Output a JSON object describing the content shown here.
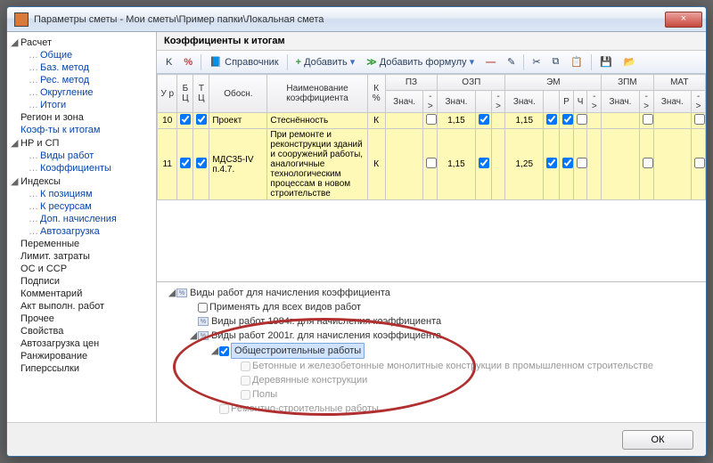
{
  "titlebar": {
    "text": "Параметры сметы - Мои сметы\\Пример папки\\Локальная смета"
  },
  "close_glyph": "×",
  "sidebar": {
    "items": [
      {
        "label": "Расчет",
        "level": 0,
        "caret": "◢"
      },
      {
        "label": "Общие",
        "level": 1
      },
      {
        "label": "Баз. метод",
        "level": 1
      },
      {
        "label": "Рес. метод",
        "level": 1
      },
      {
        "label": "Округление",
        "level": 1
      },
      {
        "label": "Итоги",
        "level": 1
      },
      {
        "label": "Регион и зона",
        "level": 0
      },
      {
        "label": "Коэф-ты к итогам",
        "level": 0,
        "selected": true
      },
      {
        "label": "НР и СП",
        "level": 0,
        "caret": "◢"
      },
      {
        "label": "Виды работ",
        "level": 1
      },
      {
        "label": "Коэффициенты",
        "level": 1
      },
      {
        "label": "Индексы",
        "level": 0,
        "caret": "◢"
      },
      {
        "label": "К позициям",
        "level": 1
      },
      {
        "label": "К ресурсам",
        "level": 1
      },
      {
        "label": "Доп. начисления",
        "level": 1
      },
      {
        "label": "Автозагрузка",
        "level": 1
      },
      {
        "label": "Переменные",
        "level": 0
      },
      {
        "label": "Лимит. затраты",
        "level": 0
      },
      {
        "label": "ОС и ССР",
        "level": 0
      },
      {
        "label": "Подписи",
        "level": 0
      },
      {
        "label": "Комментарий",
        "level": 0
      },
      {
        "label": "Акт выполн. работ",
        "level": 0
      },
      {
        "label": "Прочее",
        "level": 0
      },
      {
        "label": "Свойства",
        "level": 0
      },
      {
        "label": "Автозагрузка цен",
        "level": 0
      },
      {
        "label": "Ранжирование",
        "level": 0
      },
      {
        "label": "Гиперссылки",
        "level": 0
      }
    ]
  },
  "main": {
    "header": "Коэффициенты к итогам",
    "toolbar": {
      "k_label": "K",
      "pct_label": "%",
      "handbook": "Справочник",
      "add": "Добавить",
      "add_formula": "Добавить формулу",
      "minus_glyph": "—",
      "edit_glyph": "✎",
      "cut_glyph": "✂",
      "copy_glyph": "⧉",
      "paste_glyph": "📋",
      "save_glyph": "💾",
      "open_glyph": "📂",
      "dropdown_glyph": "▾",
      "plus_glyph": "+",
      "formula_glyph": "≫"
    },
    "columns": {
      "ur": "У\nр",
      "bc": "Б\nЦ",
      "tc": "Т\nЦ",
      "obosn": "Обосн.",
      "naim": "Наименование\nкоэффициента",
      "k_pct": "К\n%",
      "pz": "ПЗ",
      "ozp": "ОЗП",
      "em": "ЭМ",
      "zpm": "ЗПМ",
      "mat": "МАТ",
      "znach": "Знач.",
      "arrow": "->",
      "r": "Р",
      "ch": "Ч"
    },
    "rows": [
      {
        "num": "10",
        "bc": true,
        "tc": true,
        "obosn": "Проект",
        "naim": "Стеснённость",
        "k": "К",
        "ozp_val": "1,15",
        "ozp_chk": true,
        "em_val": "1,15",
        "em_chk": true,
        "em_r": true,
        "em_ch": false
      },
      {
        "num": "11",
        "bc": true,
        "tc": true,
        "obosn": "МДС35-IV п.4.7.",
        "naim": "При ремонте и реконструкции зданий и сооружений работы, аналогичные технологическим процессам в новом строительстве",
        "k": "К",
        "ozp_val": "1,15",
        "ozp_chk": true,
        "em_val": "1,25",
        "em_chk": true,
        "em_r": true,
        "em_ch": false
      }
    ]
  },
  "lower": {
    "items": [
      {
        "label": "Виды работ для начисления коэффициента",
        "level": 0,
        "caret": "◢",
        "icon": "%"
      },
      {
        "label": "Применять для всех видов работ",
        "level": 1,
        "chk": false
      },
      {
        "label": "Виды работ 1984г. для начисления коэффициента",
        "level": 1,
        "icon": "%"
      },
      {
        "label": "Виды работ 2001г. для начисления коэффициента",
        "level": 1,
        "caret": "◢",
        "icon": "%"
      },
      {
        "label": "Общестроительные работы",
        "level": 2,
        "caret": "◢",
        "chk": true,
        "sel": true
      },
      {
        "label": "Бетонные и железобетонные монолитные конструкции в промышленном строительстве",
        "level": 3,
        "chk": false,
        "disabled": true
      },
      {
        "label": "Деревянные конструкции",
        "level": 3,
        "chk": false,
        "disabled": true
      },
      {
        "label": "Полы",
        "level": 3,
        "chk": false,
        "disabled": true
      },
      {
        "label": "Ремонтно-строительные работы",
        "level": 2,
        "chk": false,
        "disabled": true
      }
    ]
  },
  "footer": {
    "ok": "ОК"
  }
}
